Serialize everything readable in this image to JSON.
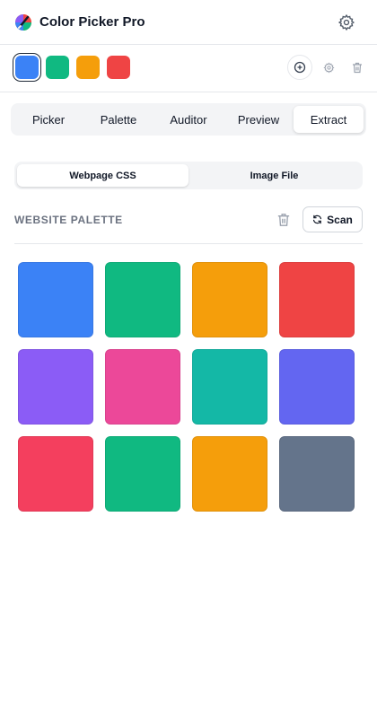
{
  "app": {
    "title": "Color Picker Pro"
  },
  "header": {
    "settings_icon": "gear-icon"
  },
  "toolbar": {
    "recent_swatches": [
      "#3b82f6",
      "#10b981",
      "#f59e0b",
      "#ef4444"
    ],
    "tools": [
      "add-circle-icon",
      "gear-icon",
      "trash-icon"
    ]
  },
  "tabs": [
    {
      "label": "Picker"
    },
    {
      "label": "Palette"
    },
    {
      "label": "Auditor"
    },
    {
      "label": "Preview"
    },
    {
      "label": "Extract",
      "active": true
    }
  ],
  "source_toggle": {
    "options": [
      "Webpage CSS",
      "Image File"
    ],
    "selected": "Webpage CSS"
  },
  "section": {
    "title": "WEBSITE PALETTE",
    "scan_label": "Scan"
  },
  "palette": [
    "#3b82f6",
    "#10b981",
    "#f59e0b",
    "#ef4444",
    "#8b5cf6",
    "#ec4899",
    "#14b8a6",
    "#6366f1",
    "#f43f5e",
    "#10b981",
    "#f59e0b",
    "#64748b"
  ]
}
